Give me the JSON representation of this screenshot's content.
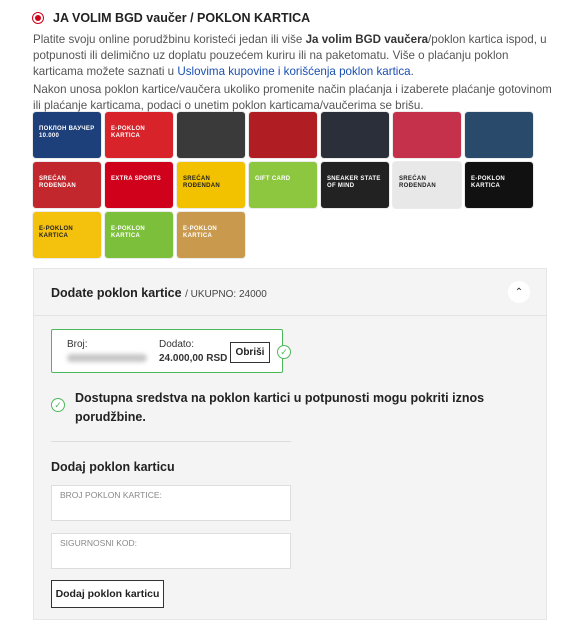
{
  "option": {
    "label": "JA VOLIM BGD vaučer / POKLON KARTICA",
    "selected": true
  },
  "description": {
    "p1_start": "Platite svoju online porudžbinu koristeći jedan ili više ",
    "p1_bold": "Ja volim BGD vaučera",
    "p1_mid": "/poklon kartica ispod, u potpunosti ili delimično uz doplatu pouzećem kuriru ili na paketomatu. Više o plaćanju poklon karticama možete saznati u ",
    "p1_link": "Uslovima kupovine i korišćenja poklon kartica",
    "p1_end": ".",
    "p2": "Nakon unosa poklon kartice/vaučera ukoliko promenite način plaćanja i izaberete plaćanje gotovinom ili plaćanje karticama, podaci o unetim poklon karticama/vaučerima se brišu."
  },
  "cards": [
    {
      "text": "ПОКЛОН ВАУЧЕР 10.000",
      "bg": "#1d3f7a"
    },
    {
      "text": "E-POKLON KARTICA",
      "bg": "#d8232a"
    },
    {
      "text": "",
      "bg": "#3a3a3a"
    },
    {
      "text": "",
      "bg": "#b01e23"
    },
    {
      "text": "",
      "bg": "#2b2f3a"
    },
    {
      "text": "",
      "bg": "#c5314a"
    },
    {
      "text": "",
      "bg": "#2a4a6b"
    },
    {
      "text": "SREĆAN ROĐENDAN",
      "bg": "#c1272d"
    },
    {
      "text": "EXTRA SPORTS",
      "bg": "#d0021b"
    },
    {
      "text": "SREĆAN ROĐENDAN",
      "bg": "#f2c200"
    },
    {
      "text": "GIFT CARD",
      "bg": "#8dc63f"
    },
    {
      "text": "SNEAKER STATE OF MIND",
      "bg": "#222222"
    },
    {
      "text": "SREĆAN ROĐENDAN",
      "bg": "#e8e8e8"
    },
    {
      "text": "E-POKLON KARTICA",
      "bg": "#111111"
    },
    {
      "text": "E-POKLON KARTICA",
      "bg": "#f4c20d"
    },
    {
      "text": "E-POKLON KARTICA",
      "bg": "#7bbf3a"
    },
    {
      "text": "E-POKLON KARTICA",
      "bg": "#c99a4e"
    }
  ],
  "panel": {
    "title": "Dodate poklon kartice",
    "total": "/ UKUPNO: 24000",
    "card": {
      "number_label": "Broj:",
      "added_label": "Dodato:",
      "added_value": "24.000,00 RSD",
      "remove_label": "Obriši"
    },
    "notice": "Dostupna sredstva na poklon kartici u potpunosti mogu pokriti iznos porudžbine.",
    "add_title": "Dodaj poklon karticu",
    "card_number_placeholder": "BROJ POKLON KARTICE:",
    "security_code_placeholder": "SIGURNOSNI KOD:",
    "add_button": "Dodaj poklon karticu"
  }
}
